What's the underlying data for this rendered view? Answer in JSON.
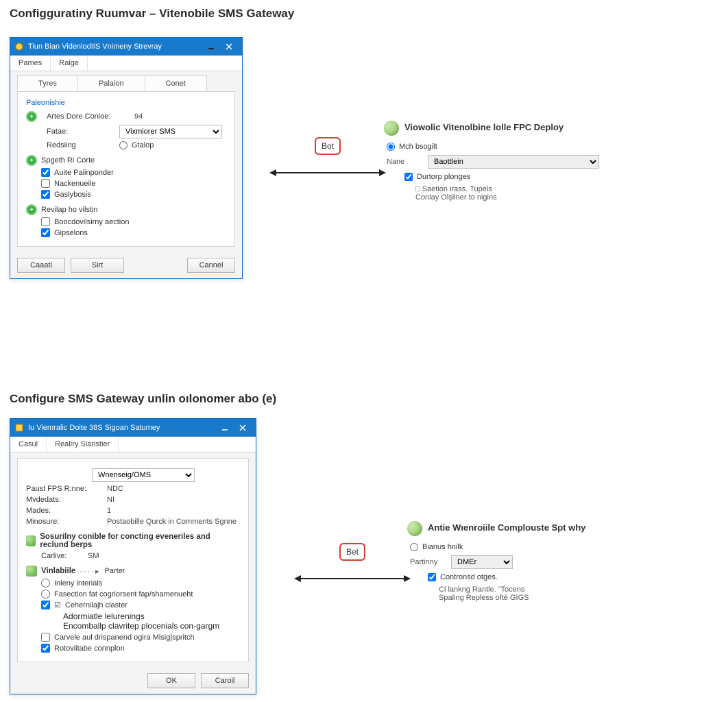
{
  "titles": {
    "top": "Configguratiny Ruumvar – Vitenobile SMS Gateway",
    "bottom": "Configure SMS Gateway unlin oılonomer abo (e)"
  },
  "window1": {
    "title": "Tiun Bian VideniodIIS Vnimeny Strevray",
    "tabs": [
      "Pames",
      "Raige"
    ],
    "subtabs": [
      "Tyres",
      "Palaion",
      "Conet"
    ],
    "group_title": "Paleonishie",
    "fields": {
      "artes_label": "Artes Dore Conioe:",
      "artes_value": "94",
      "fatae_label": "Fatae:",
      "fatae_value": "Vixmiorer SMS",
      "redsing_label": "Redsiing",
      "redsing_option": "Gtalop"
    },
    "sec1_header": "Spgeth Ri Corte",
    "sec1": {
      "c1": "Auite Paiinponder",
      "c2": "Nackenueile",
      "c3": "Gaslybosis"
    },
    "sec2_header": "Revilap ho vilstin",
    "sec2": {
      "c1": "Boocdovilsirny aection",
      "c2": "Gipselons"
    },
    "buttons": {
      "cancel_left": "Caaatl",
      "set": "Sirt",
      "cancel_right": "Cannel"
    }
  },
  "arrow1_label": "Bot",
  "rpanel1": {
    "heading": "Viowolic Vitenolbine lolle FPC Deploy",
    "radio_label": "Mch bsogilt",
    "none_label": "Nane",
    "none_value": "Baottlein",
    "c1": "Durtorp plonges",
    "sub1": "Saetion irass. Tupels",
    "sub2": "Conlay Olşliner to nigins"
  },
  "window2": {
    "title": "Iu Viemralic Doite 38S Sigoan Satumey",
    "tabs": [
      "Casul",
      "Realiry Slaristier"
    ],
    "top_combo": "Wnenseig/OMS",
    "fields": {
      "f1l": "Paust FPS R:nne:",
      "f1v": "NDC",
      "f2l": "Mvdedats:",
      "f2v": "NI",
      "f3l": "Mades:",
      "f3v": "1",
      "f4l": "Minosure:",
      "f4v": "Postaobille Qurck in Comments Sgnne"
    },
    "sec_conible": {
      "head": "Sosurilny conible for concting eveneriles and reclund berps",
      "carlive_lbl": "Carlive:",
      "carlive_val": "SM"
    },
    "sec_paner": {
      "head_left": "Vinlabiile",
      "head_right": "Parter",
      "r1": "Inleny interials",
      "r2": "Fasection fat cogriorsent fap/shamenueht",
      "c1": "Cehernilajh claster",
      "c1a": "Adormiatle lelurenings",
      "c1b": "Encomballp clavritep plocenials con-gargm",
      "c2": "Carvele aul drispanend ogira Misig|spritch",
      "c3": "Rotoviitabe connplon"
    },
    "buttons": {
      "ok": "OK",
      "cancel": "Caroil"
    }
  },
  "arrow2_label": "Bet",
  "rpanel2": {
    "heading": "Antie Wıenroiile Complouste Spt why",
    "radio_label": "Bianus hnilk",
    "partinny_label": "Partinny",
    "partinny_value": "DMEr",
    "c1": "Contronsd otges.",
    "sub1": "Cl lankng Rantle. “Tocens",
    "sub2": "Spaling Repless ofté GIGS"
  }
}
